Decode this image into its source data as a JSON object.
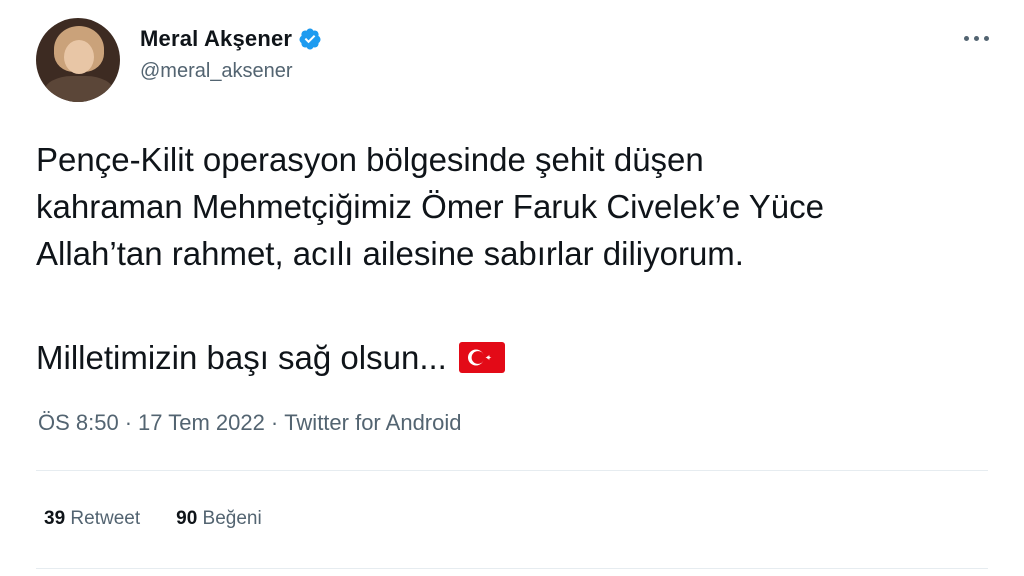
{
  "author": {
    "name": "Meral Akşener",
    "handle": "@meral_aksener"
  },
  "tweet": {
    "lines": [
      "Pençe-Kilit operasyon bölgesinde şehit düşen",
      "kahraman Mehmetçiğimiz Ömer Faruk Civelek’e Yüce",
      "Allah’tan rahmet, acılı ailesine sabırlar diliyorum."
    ],
    "line2": "Milletimizin başı sağ olsun...",
    "flag_icon": "turkey-flag-emoji"
  },
  "meta": {
    "time": "ÖS 8:50",
    "separator": "·",
    "date": "17 Tem 2022",
    "source": "Twitter for Android"
  },
  "stats": {
    "retweets_count": "39",
    "retweets_label": "Retweet",
    "likes_count": "90",
    "likes_label": "Beğeni"
  },
  "colors": {
    "verified_blue": "#1d9bf0",
    "flag_red": "#e30a17",
    "secondary_text": "#536471"
  }
}
